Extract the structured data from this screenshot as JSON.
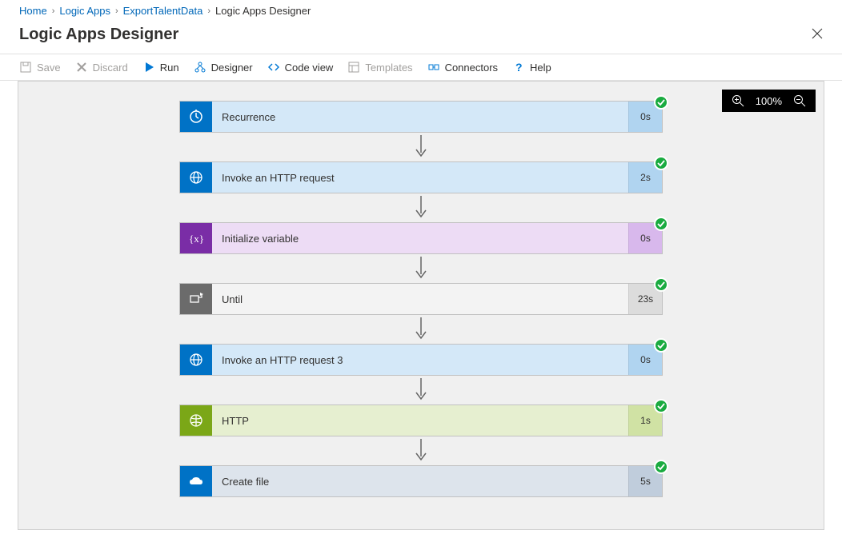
{
  "breadcrumb": {
    "items": [
      {
        "label": "Home"
      },
      {
        "label": "Logic Apps"
      },
      {
        "label": "ExportTalentData"
      }
    ],
    "current": "Logic Apps Designer"
  },
  "header": {
    "title": "Logic Apps Designer"
  },
  "toolbar": {
    "save": "Save",
    "discard": "Discard",
    "run": "Run",
    "designer": "Designer",
    "codeview": "Code view",
    "templates": "Templates",
    "connectors": "Connectors",
    "help": "Help"
  },
  "zoom": {
    "level": "100%"
  },
  "steps": [
    {
      "label": "Recurrence",
      "time": "0s",
      "icon": "clock",
      "theme": "blue"
    },
    {
      "label": "Invoke an HTTP request",
      "time": "2s",
      "icon": "globe",
      "theme": "blue"
    },
    {
      "label": "Initialize variable",
      "time": "0s",
      "icon": "variable",
      "theme": "purple"
    },
    {
      "label": "Until",
      "time": "23s",
      "icon": "loop",
      "theme": "gray"
    },
    {
      "label": "Invoke an HTTP request 3",
      "time": "0s",
      "icon": "globe",
      "theme": "blue"
    },
    {
      "label": "HTTP",
      "time": "1s",
      "icon": "http",
      "theme": "green"
    },
    {
      "label": "Create file",
      "time": "5s",
      "icon": "onedrive",
      "theme": "steel"
    }
  ]
}
